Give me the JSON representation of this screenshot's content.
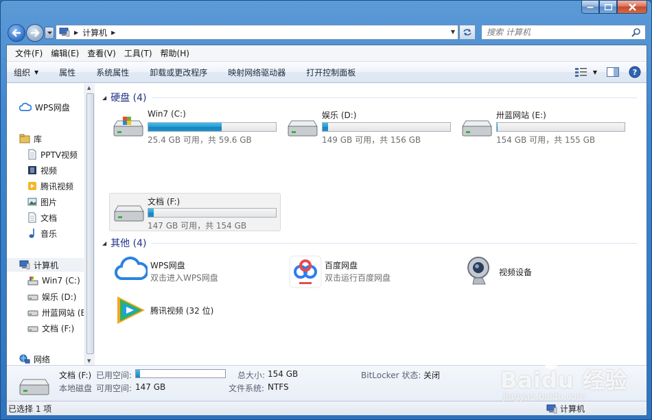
{
  "window": {
    "minimize_icon": "minimize-icon",
    "maximize_icon": "maximize-icon",
    "close_icon": "close-icon"
  },
  "address_bar": {
    "path": "计算机",
    "search_placeholder": "搜索 计算机"
  },
  "menu": {
    "file": "文件(F)",
    "edit": "编辑(E)",
    "view": "查看(V)",
    "tools": "工具(T)",
    "help": "帮助(H)"
  },
  "commands": {
    "organize": "组织",
    "properties": "属性",
    "system_properties": "系统属性",
    "uninstall": "卸载或更改程序",
    "map_drive": "映射网络驱动器",
    "control_panel": "打开控制面板"
  },
  "sidebar": {
    "wps": "WPS网盘",
    "libraries": "库",
    "pptv": "PPTV视频",
    "videos": "视频",
    "tencent_video": "腾讯视频",
    "pictures": "图片",
    "documents": "文档",
    "music": "音乐",
    "computer": "计算机",
    "drive_c": "Win7 (C:)",
    "drive_d": "娱乐 (D:)",
    "drive_e": "卅蓝网站 (E:)",
    "drive_f": "文档 (F:)",
    "network": "网络"
  },
  "groups": {
    "hard_drives": "硬盘 (4)",
    "other": "其他 (4)"
  },
  "drives": [
    {
      "name": "Win7 (C:)",
      "free_text": "25.4 GB 可用，共 59.6 GB",
      "used_fraction": 0.574
    },
    {
      "name": "娱乐 (D:)",
      "free_text": "149 GB 可用，共 156 GB",
      "used_fraction": 0.045
    },
    {
      "name": "卅蓝网站 (E:)",
      "free_text": "154 GB 可用，共 155 GB",
      "used_fraction": 0.006
    },
    {
      "name": "文档 (F:)",
      "free_text": "147 GB 可用，共 154 GB",
      "used_fraction": 0.045
    }
  ],
  "other_items": [
    {
      "name": "WPS网盘",
      "sub": "双击进入WPS网盘"
    },
    {
      "name": "百度网盘",
      "sub": "双击运行百度网盘"
    },
    {
      "name": "视频设备",
      "sub": ""
    },
    {
      "name": "腾讯视频 (32 位)",
      "sub": ""
    }
  ],
  "details": {
    "name": "文档 (F:)",
    "type": "本地磁盘",
    "used_label": "已用空间:",
    "free_label": "可用空间:",
    "free_value": "147 GB",
    "total_label": "总大小:",
    "total_value": "154 GB",
    "fs_label": "文件系统:",
    "fs_value": "NTFS",
    "bitlocker_label": "BitLocker 状态:",
    "bitlocker_value": "关闭",
    "used_fraction": 0.045
  },
  "status": {
    "selected": "已选择 1 项",
    "location": "计算机"
  },
  "watermark": {
    "brand": "Baidu 经验",
    "url": "jingyan.baidu.com"
  }
}
